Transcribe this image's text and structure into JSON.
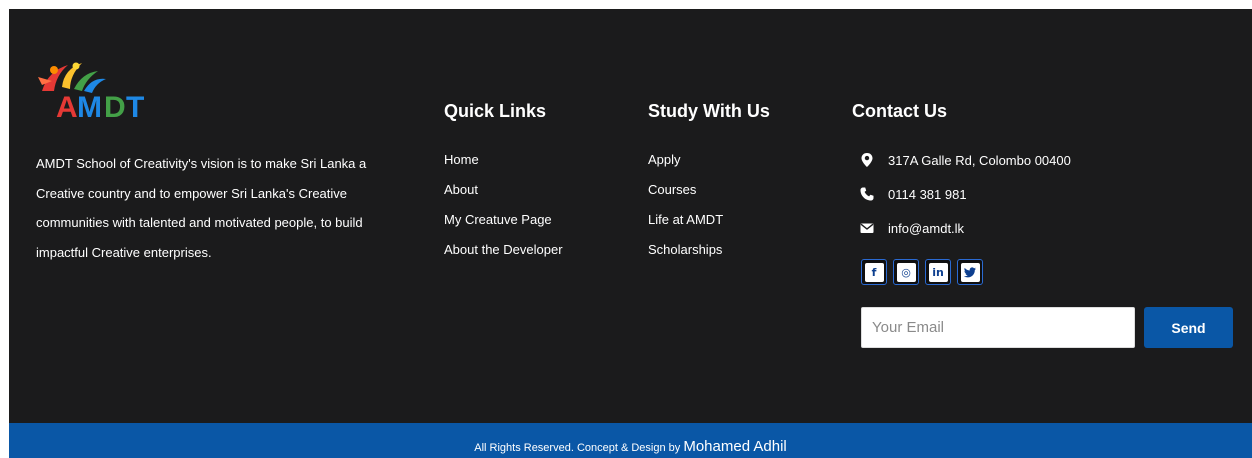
{
  "brand": {
    "logo_text": "AMDT"
  },
  "about": {
    "text": "AMDT School of Creativity's vision is to make Sri Lanka a Creative country and to empower Sri Lanka's Creative communities with talented and motivated people, to build impactful Creative enterprises."
  },
  "quick_links": {
    "heading": "Quick Links",
    "items": [
      {
        "label": "Home"
      },
      {
        "label": "About"
      },
      {
        "label": "My Creatuve Page"
      },
      {
        "label": "About the Developer"
      }
    ]
  },
  "study": {
    "heading": "Study With Us",
    "items": [
      {
        "label": "Apply"
      },
      {
        "label": "Courses"
      },
      {
        "label": "Life at AMDT"
      },
      {
        "label": "Scholarships"
      }
    ]
  },
  "contact": {
    "heading": "Contact Us",
    "address": "317A Galle Rd, Colombo 00400",
    "phone": "0114 381 981",
    "email": "info@amdt.lk",
    "icons": [
      "map-marker-icon",
      "phone-icon",
      "envelope-icon"
    ]
  },
  "social": [
    {
      "icon": "facebook-icon",
      "glyph": "f"
    },
    {
      "icon": "instagram-icon",
      "glyph": "◎"
    },
    {
      "icon": "linkedin-icon",
      "glyph": "in"
    },
    {
      "icon": "twitter-icon",
      "glyph": "🐦"
    }
  ],
  "newsletter": {
    "placeholder": "Your Email",
    "button_label": "Send"
  },
  "bottom_bar": {
    "text": "All Rights Reserved. Concept & Design by ",
    "author": "Mohamed Adhil"
  },
  "colors": {
    "footer_bg": "#1b1b1c",
    "accent_blue": "#0a57a6",
    "text": "#ffffff"
  }
}
